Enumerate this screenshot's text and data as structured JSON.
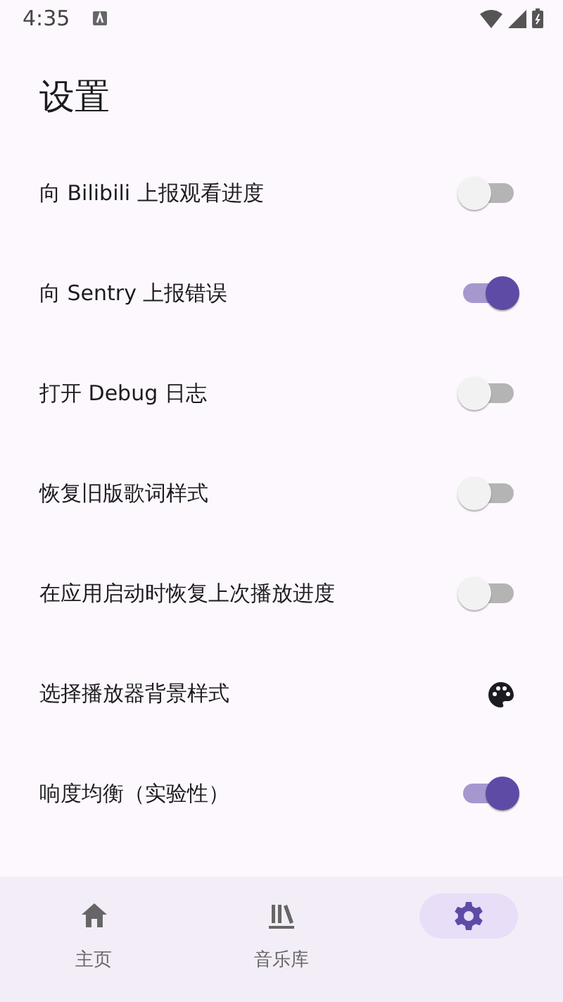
{
  "status_bar": {
    "time": "4:35"
  },
  "title": "设置",
  "settings": [
    {
      "kind": "switch",
      "label": "向 Bilibili 上报观看进度",
      "on": false
    },
    {
      "kind": "switch",
      "label": "向 Sentry 上报错误",
      "on": true
    },
    {
      "kind": "switch",
      "label": "打开 Debug 日志",
      "on": false
    },
    {
      "kind": "switch",
      "label": "恢复旧版歌词样式",
      "on": false
    },
    {
      "kind": "switch",
      "label": "在应用启动时恢复上次播放进度",
      "on": false
    },
    {
      "kind": "palette",
      "label": "选择播放器背景样式"
    },
    {
      "kind": "switch",
      "label": "响度均衡（实验性）",
      "on": true
    }
  ],
  "nav": [
    {
      "kind": "home",
      "label": "主页",
      "selected": false
    },
    {
      "kind": "library",
      "label": "音乐库",
      "selected": false
    },
    {
      "kind": "settings",
      "selected": true
    }
  ]
}
